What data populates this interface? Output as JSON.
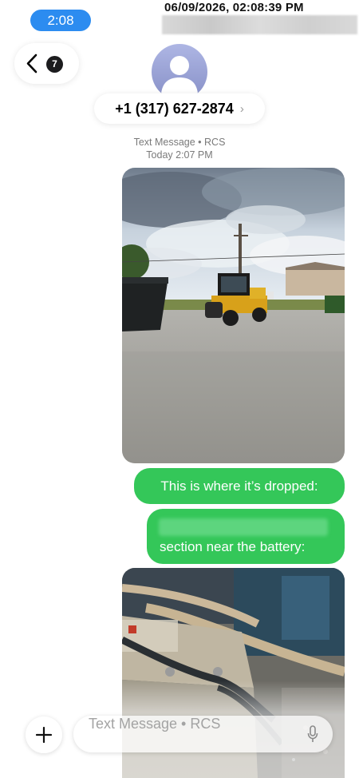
{
  "status": {
    "time": "2:08",
    "timestamp": "06/09/2026, 02:08:39 PM"
  },
  "header": {
    "unread_count": "7",
    "contact": "+1 (317) 627-2874",
    "chevron": "›"
  },
  "thread": {
    "service": "Text Message • RCS",
    "date": "Today 2:07 PM"
  },
  "messages": [
    {
      "type": "image",
      "description_icon": "photo-icon"
    },
    {
      "type": "text",
      "text": "This is where it’s dropped:"
    },
    {
      "type": "text",
      "text": "section near the battery:"
    },
    {
      "type": "image",
      "description_icon": "photo-icon"
    }
  ],
  "compose": {
    "placeholder": "Text Message • RCS"
  },
  "colors": {
    "bubble": "#34c759",
    "time_pill": "#2c8cf0",
    "avatar": "#9aa2d6"
  }
}
